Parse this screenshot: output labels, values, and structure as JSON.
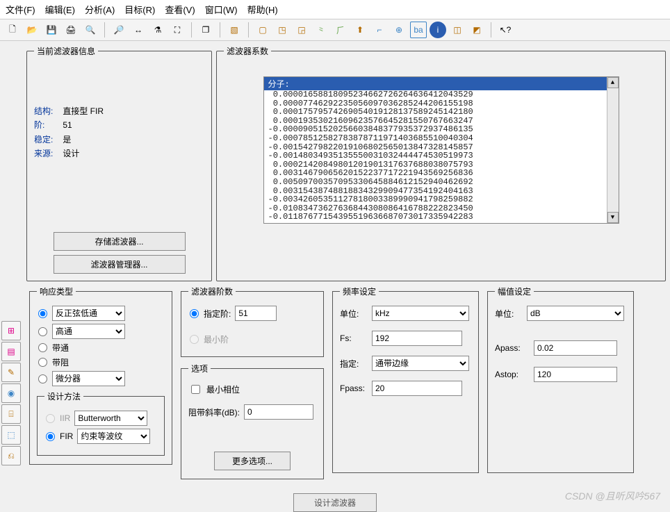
{
  "menu": {
    "file": "文件(F)",
    "edit": "编辑(E)",
    "analysis": "分析(A)",
    "target": "目标(R)",
    "view": "查看(V)",
    "window": "窗口(W)",
    "help": "帮助(H)"
  },
  "toolbar_icons": [
    "new-icon",
    "open-icon",
    "save-icon",
    "print-icon",
    "print-preview-icon",
    "zoom-in-icon",
    "zoom-out-icon",
    "measure-icon",
    "full-extent-icon",
    "copy-icon",
    "response-icon",
    "magnitude-icon",
    "phase-icon",
    "impulse-icon",
    "step-icon",
    "group-delay-icon",
    "pole-zero-icon",
    "filter-overlay-icon",
    "round-icon",
    "info-icon",
    "chart1-icon",
    "chart2-icon",
    "help-cursor-icon"
  ],
  "side_icons": [
    "layout1-icon",
    "layout2-icon",
    "tool1-icon",
    "tool2-icon",
    "tool3-icon",
    "tool4-icon",
    "tool5-icon"
  ],
  "info_panel": {
    "legend": "当前滤波器信息",
    "structure_label": "结构:",
    "structure_value": "直接型 FIR",
    "order_label": "阶:",
    "order_value": "51",
    "stable_label": "稳定:",
    "stable_value": "是",
    "source_label": "来源:",
    "source_value": "设计",
    "store_btn": "存储滤波器...",
    "manager_btn": "滤波器管理器..."
  },
  "coef_panel": {
    "legend": "滤波器系数",
    "header": "分子:",
    "lines": [
      " 0.00001658818095234662726264636412043529",
      " 0.00007746292235056097036285244206155198",
      " 0.00017579574269054019128137589245142180",
      " 0.00019353021609623576645281550767663247",
      "-0.00009051520256603848377935372937486135",
      "-0.00078512582783878711971403685510040304",
      "-0.00154279822019106802565013847328145857",
      "-0.00148034935135550031032444474530519973",
      " 0.00021420849801201901317637688038075793",
      " 0.00314679065620152237717221943569256836",
      " 0.00509700357095330645884612152940462692",
      " 0.00315438748818834329909477354192404163",
      "-0.00342605351127818003389990941798259882",
      "-0.01083473627636844308086416788222823450",
      "-0.01187677154395519636687073017335942283"
    ]
  },
  "resp": {
    "legend": "响应类型",
    "opt1": "反正弦低通",
    "opt2": "高通",
    "opt3": "带通",
    "opt4": "带阻",
    "opt5": "微分器",
    "method_legend": "设计方法",
    "iir_label": "IIR",
    "iir_sel": "Butterworth",
    "fir_label": "FIR",
    "fir_sel": "约束等波纹"
  },
  "order": {
    "legend": "滤波器阶数",
    "specify_label": "指定阶:",
    "specify_value": "51",
    "min_label": "最小阶"
  },
  "options": {
    "legend": "选项",
    "min_phase_label": "最小相位",
    "stop_slope_label": "阻带斜率(dB):",
    "stop_slope_value": "0",
    "more_btn": "更多选项..."
  },
  "freq": {
    "legend": "频率设定",
    "unit_label": "单位:",
    "unit_value": "kHz",
    "fs_label": "Fs:",
    "fs_value": "192",
    "spec_label": "指定:",
    "spec_value": "通带边缘",
    "fpass_label": "Fpass:",
    "fpass_value": "20"
  },
  "mag": {
    "legend": "幅值设定",
    "unit_label": "单位:",
    "unit_value": "dB",
    "apass_label": "Apass:",
    "apass_value": "0.02",
    "astop_label": "Astop:",
    "astop_value": "120"
  },
  "design_btn": "设计滤波器",
  "watermark": "CSDN @且听风吟567"
}
